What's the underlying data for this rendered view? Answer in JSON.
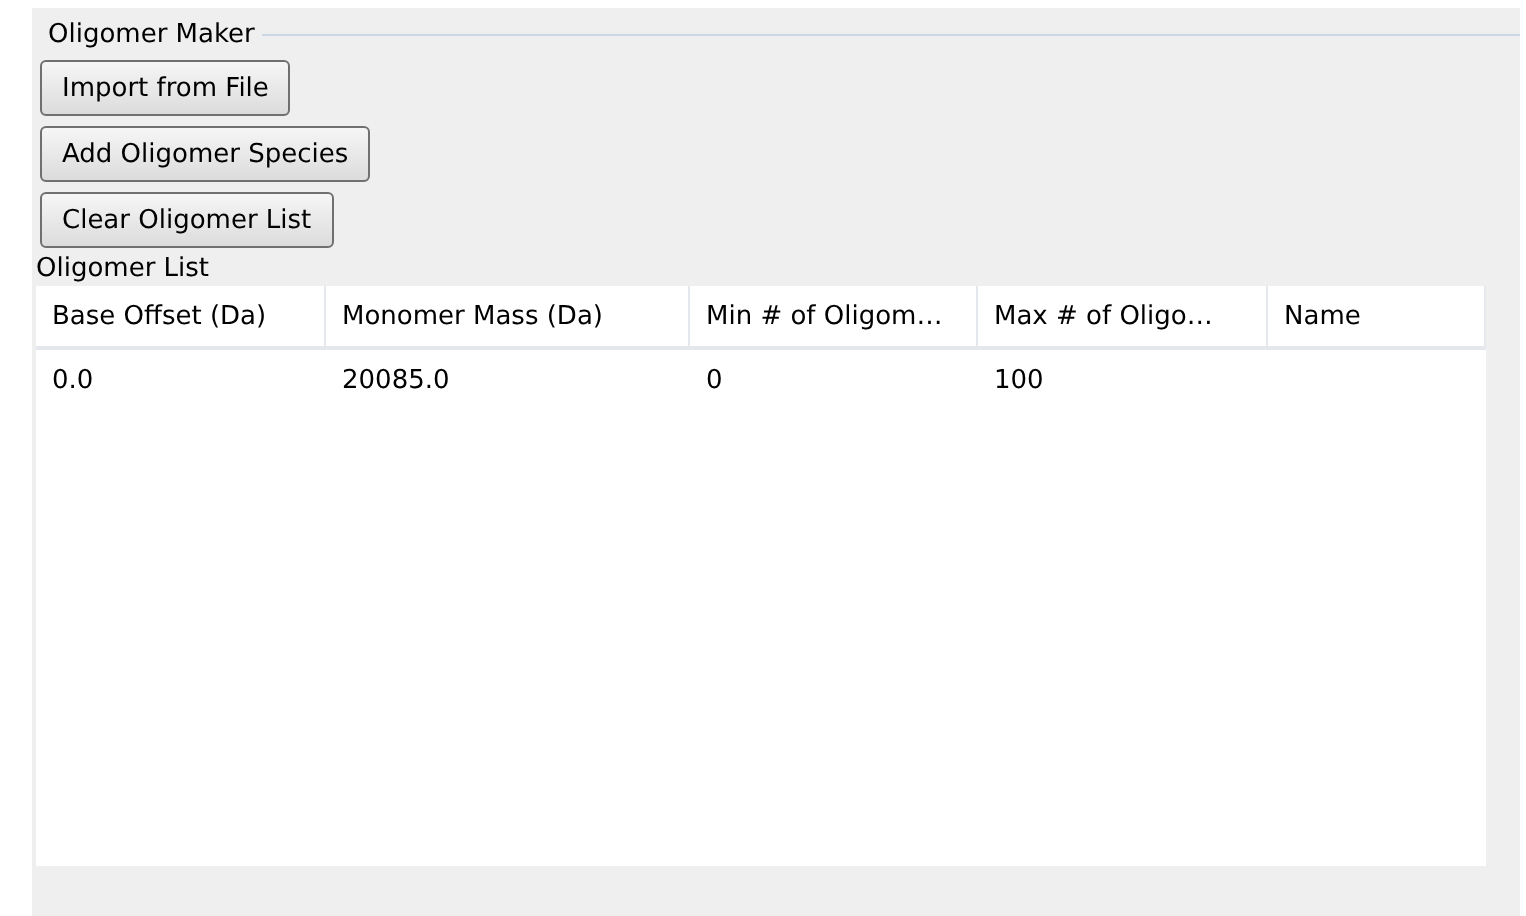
{
  "group": {
    "title": "Oligomer Maker"
  },
  "buttons": [
    "Import from File",
    "Add Oligomer Species",
    "Clear Oligomer List"
  ],
  "list_label": "Oligomer List",
  "table": {
    "columns": [
      "Base Offset (Da)",
      "Monomer Mass (Da)",
      "Min # of Oligom…",
      "Max # of Oligo…",
      "Name"
    ],
    "rows": [
      [
        "0.0",
        "20085.0",
        "0",
        "100",
        ""
      ]
    ]
  }
}
